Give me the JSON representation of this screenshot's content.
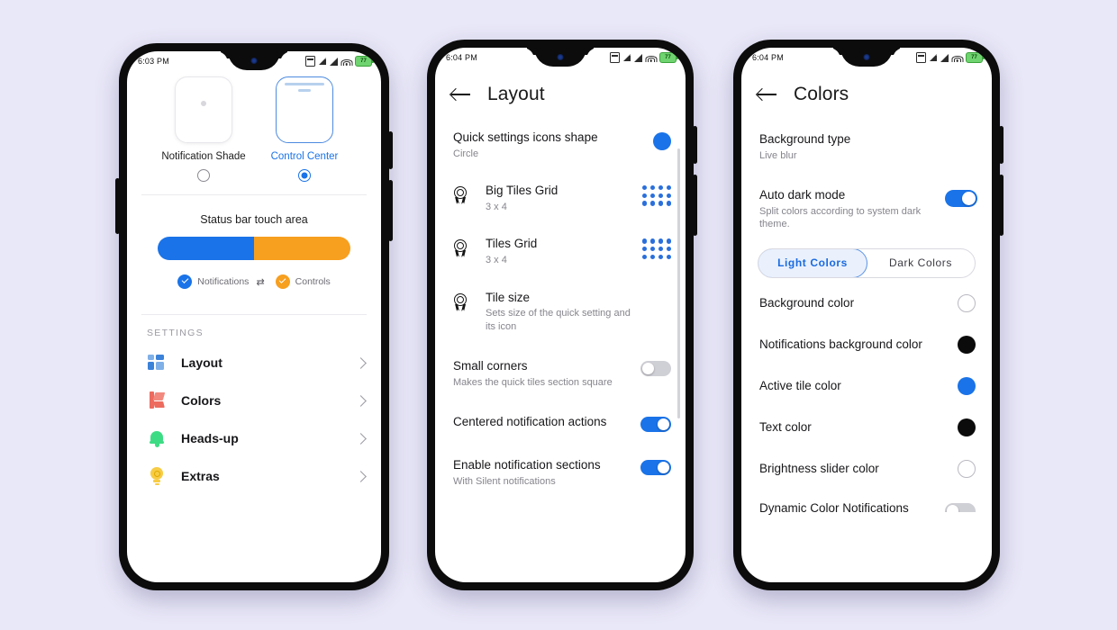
{
  "background_color": "#e9e8f8",
  "statusbar": {
    "time_phone1": "6:03 PM",
    "time_phone2": "6:04 PM",
    "time_phone3": "6:04 PM",
    "battery_level": "77",
    "icons": [
      "sd-card-icon",
      "signal-1-icon",
      "signal-2-icon",
      "wifi-icon",
      "battery-icon"
    ]
  },
  "phone1": {
    "mode_selector": {
      "options": [
        {
          "label": "Notification Shade",
          "selected": false
        },
        {
          "label": "Control Center",
          "selected": true
        }
      ]
    },
    "touch_area": {
      "title": "Status bar touch area",
      "split_percent": 50,
      "left_color": "#1a73e8",
      "right_color": "#f79f1f",
      "legend": [
        {
          "label": "Notifications",
          "color": "#1a73e8"
        },
        {
          "label": "Controls",
          "color": "#f79f1f"
        }
      ],
      "swap_icon": "swap-arrows-icon"
    },
    "settings": {
      "section_label": "SETTINGS",
      "items": [
        {
          "label": "Layout",
          "icon": "grid-layout-icon",
          "color": "#3b82d9"
        },
        {
          "label": "Colors",
          "icon": "color-palette-icon",
          "color": "#ec6b5e"
        },
        {
          "label": "Heads-up",
          "icon": "bell-icon",
          "color": "#3ddc84"
        },
        {
          "label": "Extras",
          "icon": "lightbulb-icon",
          "color": "#f7cc45"
        }
      ]
    }
  },
  "phone2": {
    "title": "Layout",
    "back_icon": "back-arrow-icon",
    "rows": [
      {
        "title": "Quick settings icons shape",
        "sub": "Circle",
        "control": "circle-swatch",
        "value_color": "#1a73e8",
        "badge": false
      },
      {
        "title": "Big Tiles Grid",
        "sub": "3 x 4",
        "control": "dot-grid",
        "grid_rows": 3,
        "grid_cols": 4,
        "badge": true
      },
      {
        "title": "Tiles Grid",
        "sub": "3 x 4",
        "control": "dot-grid",
        "grid_rows": 3,
        "grid_cols": 4,
        "badge": true
      },
      {
        "title": "Tile size",
        "sub": "Sets size of the quick setting and its icon",
        "control": "none",
        "badge": true
      },
      {
        "title": "Small corners",
        "sub": "Makes the quick tiles section square",
        "control": "toggle",
        "toggle_on": false,
        "badge": false
      },
      {
        "title": "Centered notification actions",
        "sub": "",
        "control": "toggle",
        "toggle_on": true,
        "badge": false
      },
      {
        "title": "Enable notification sections",
        "sub": "With Silent notifications",
        "control": "toggle",
        "toggle_on": true,
        "badge": false
      }
    ]
  },
  "phone3": {
    "title": "Colors",
    "back_icon": "back-arrow-icon",
    "background_type": {
      "title": "Background type",
      "sub": "Live blur"
    },
    "auto_dark_mode": {
      "title": "Auto dark mode",
      "sub": "Split colors according to system dark theme.",
      "toggle_on": true
    },
    "segmented": {
      "options": [
        {
          "label": "Light Colors",
          "selected": true
        },
        {
          "label": "Dark Colors",
          "selected": false
        }
      ]
    },
    "color_rows": [
      {
        "label": "Background color",
        "swatch": "white"
      },
      {
        "label": "Notifications background color",
        "swatch": "black"
      },
      {
        "label": "Active tile color",
        "swatch": "blue"
      },
      {
        "label": "Text color",
        "swatch": "black"
      },
      {
        "label": "Brightness slider color",
        "swatch": "white"
      },
      {
        "label": "Dynamic Color Notifications",
        "swatch": "toggle-partial"
      }
    ]
  }
}
